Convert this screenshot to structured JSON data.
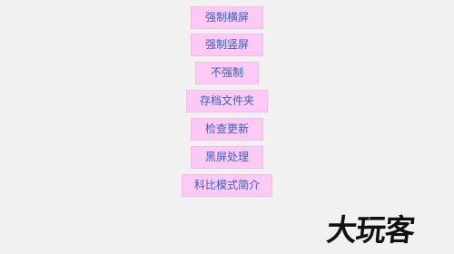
{
  "menu": {
    "items": [
      {
        "label": "强制横屏"
      },
      {
        "label": "强制竖屏"
      },
      {
        "label": "不强制"
      },
      {
        "label": "存档文件夹"
      },
      {
        "label": "检查更新"
      },
      {
        "label": "黑屏处理"
      },
      {
        "label": "科比模式简介"
      }
    ]
  },
  "watermark": {
    "text": "大玩客"
  },
  "colors": {
    "background": "#f1f1f1",
    "button_bg": "#fccaf3",
    "button_text": "#3a5fc8"
  }
}
